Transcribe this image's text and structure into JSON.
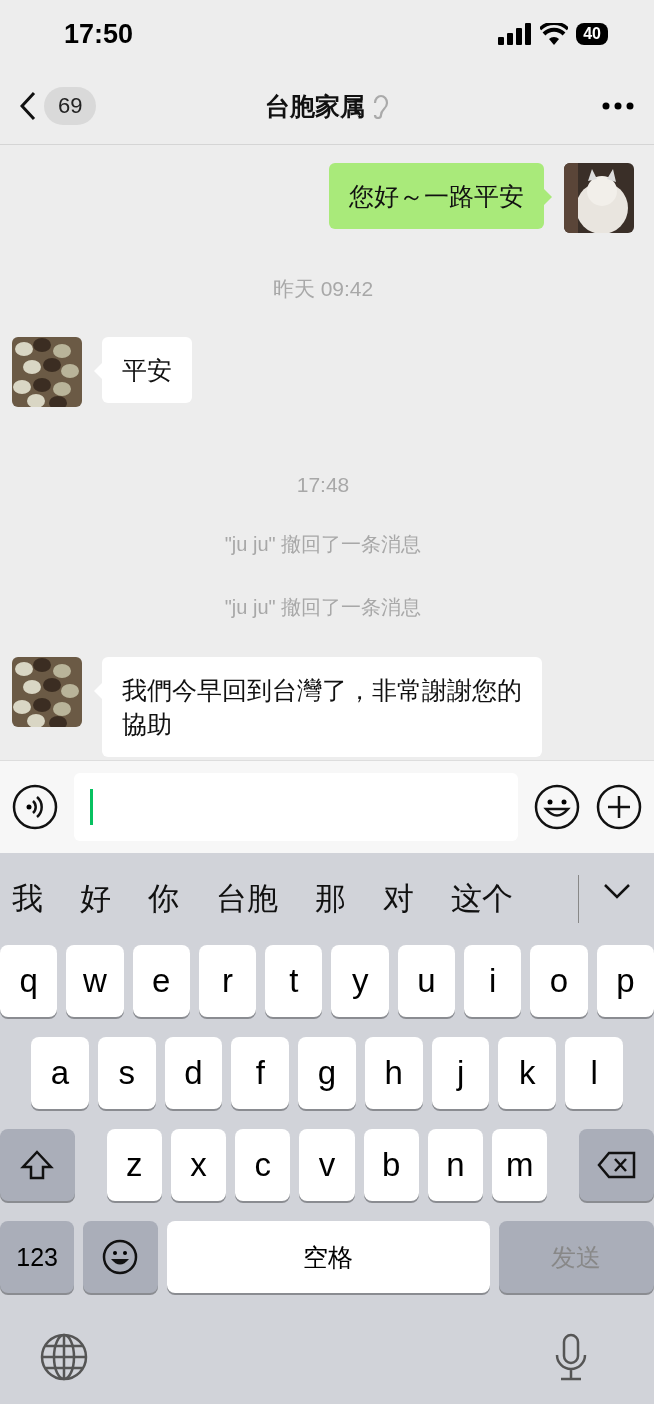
{
  "status_bar": {
    "time": "17:50",
    "battery": "40"
  },
  "nav": {
    "unread": "69",
    "title": "台胞家属",
    "muted": true
  },
  "messages": [
    {
      "kind": "outgoing",
      "text": "您好～一路平安"
    },
    {
      "kind": "time",
      "text": "昨天 09:42"
    },
    {
      "kind": "incoming",
      "text": "平安"
    },
    {
      "kind": "time",
      "text": "17:48"
    },
    {
      "kind": "system",
      "text": "\"ju ju\" 撤回了一条消息"
    },
    {
      "kind": "system",
      "text": "\"ju ju\" 撤回了一条消息"
    },
    {
      "kind": "incoming",
      "text": "我們今早回到台灣了，非常謝謝您的協助"
    }
  ],
  "keyboard": {
    "candidates": [
      "我",
      "好",
      "你",
      "台胞",
      "那",
      "对",
      "这个"
    ],
    "rows": [
      [
        "q",
        "w",
        "e",
        "r",
        "t",
        "y",
        "u",
        "i",
        "o",
        "p"
      ],
      [
        "a",
        "s",
        "d",
        "f",
        "g",
        "h",
        "j",
        "k",
        "l"
      ],
      [
        "z",
        "x",
        "c",
        "v",
        "b",
        "n",
        "m"
      ]
    ],
    "numbers_key": "123",
    "space_key": "空格",
    "send_key": "发送",
    "send_disabled": true
  }
}
